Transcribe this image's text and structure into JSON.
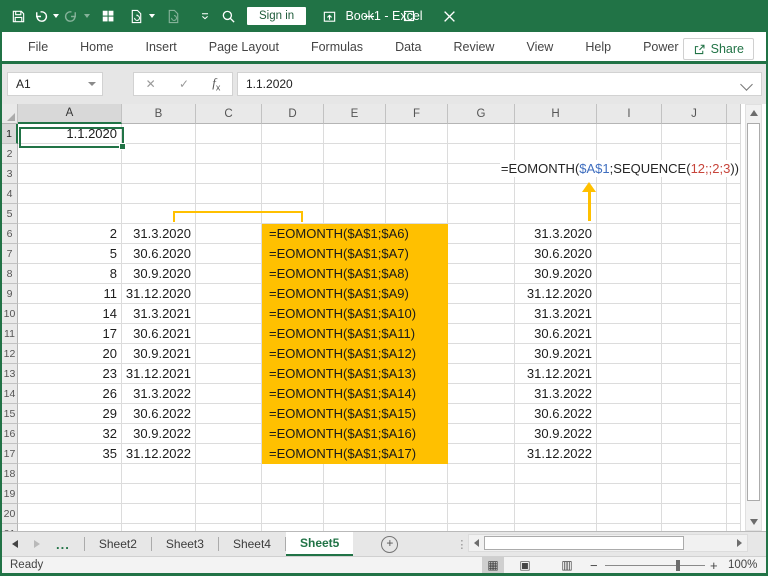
{
  "titlebar": {
    "title": "Book1 - Excel",
    "sign_in_label": "Sign in",
    "quick_access_icons": [
      "save-icon",
      "undo-icon",
      "redo-icon",
      "grid-icon",
      "document-refresh-icon",
      "document-icon",
      "customize-qat-icon"
    ],
    "window_icons": [
      "search-icon",
      "ribbon-display-options-icon",
      "minimize-icon",
      "maximize-icon",
      "close-icon"
    ]
  },
  "ribbon": {
    "tabs": [
      "File",
      "Home",
      "Insert",
      "Page Layout",
      "Formulas",
      "Data",
      "Review",
      "View",
      "Help",
      "Power Pivot"
    ],
    "share_label": "Share"
  },
  "formula_bar": {
    "name_box_value": "A1",
    "cancel_glyph": "✕",
    "enter_glyph": "✓",
    "fx_label": "fx",
    "formula_value": "1.1.2020"
  },
  "grid": {
    "column_headers": [
      "A",
      "B",
      "C",
      "D",
      "E",
      "F",
      "G",
      "H",
      "I",
      "J"
    ],
    "row_count": 21,
    "active_cell": {
      "ref": "A1",
      "value": "1.1.2020"
    },
    "rows": [
      {
        "row": 6,
        "A": "2",
        "B": "31.3.2020",
        "DEF_formula": "=EOMONTH($A$1;$A6)",
        "H": "31.3.2020"
      },
      {
        "row": 7,
        "A": "5",
        "B": "30.6.2020",
        "DEF_formula": "=EOMONTH($A$1;$A7)",
        "H": "30.6.2020"
      },
      {
        "row": 8,
        "A": "8",
        "B": "30.9.2020",
        "DEF_formula": "=EOMONTH($A$1;$A8)",
        "H": "30.9.2020"
      },
      {
        "row": 9,
        "A": "11",
        "B": "31.12.2020",
        "DEF_formula": "=EOMONTH($A$1;$A9)",
        "H": "31.12.2020"
      },
      {
        "row": 10,
        "A": "14",
        "B": "31.3.2021",
        "DEF_formula": "=EOMONTH($A$1;$A10)",
        "H": "31.3.2021"
      },
      {
        "row": 11,
        "A": "17",
        "B": "30.6.2021",
        "DEF_formula": "=EOMONTH($A$1;$A11)",
        "H": "30.6.2021"
      },
      {
        "row": 12,
        "A": "20",
        "B": "30.9.2021",
        "DEF_formula": "=EOMONTH($A$1;$A12)",
        "H": "30.9.2021"
      },
      {
        "row": 13,
        "A": "23",
        "B": "31.12.2021",
        "DEF_formula": "=EOMONTH($A$1;$A13)",
        "H": "31.12.2021"
      },
      {
        "row": 14,
        "A": "26",
        "B": "31.3.2022",
        "DEF_formula": "=EOMONTH($A$1;$A14)",
        "H": "31.3.2022"
      },
      {
        "row": 15,
        "A": "29",
        "B": "30.6.2022",
        "DEF_formula": "=EOMONTH($A$1;$A15)",
        "H": "30.6.2022"
      },
      {
        "row": 16,
        "A": "32",
        "B": "30.9.2022",
        "DEF_formula": "=EOMONTH($A$1;$A16)",
        "H": "30.9.2022"
      },
      {
        "row": 17,
        "A": "35",
        "B": "31.12.2022",
        "DEF_formula": "=EOMONTH($A$1;$A17)",
        "H": "31.12.2022"
      }
    ]
  },
  "annotation": {
    "segments": [
      {
        "text": "=EOMONTH(",
        "color": "#262626"
      },
      {
        "text": "$A$1",
        "color": "#3f6ebf"
      },
      {
        "text": ";SEQUENCE(",
        "color": "#262626"
      },
      {
        "text": "12;;2;3",
        "color": "#c7443a"
      },
      {
        "text": "))",
        "color": "#262626"
      }
    ]
  },
  "sheet_tabs": {
    "overflow_label": "...",
    "tabs": [
      "Sheet2",
      "Sheet3",
      "Sheet4"
    ],
    "active_tab": "Sheet5",
    "add_sheet_label": "+"
  },
  "status_bar": {
    "status": "Ready",
    "zoom_level": "100%",
    "view_icons": [
      "normal-view-icon",
      "page-layout-view-icon",
      "page-break-preview-icon"
    ]
  },
  "colors": {
    "excel_green": "#217346",
    "highlight_orange": "#FFC000",
    "formula_ref_blue": "#3f6ebf",
    "formula_arg_red": "#c7443a"
  }
}
